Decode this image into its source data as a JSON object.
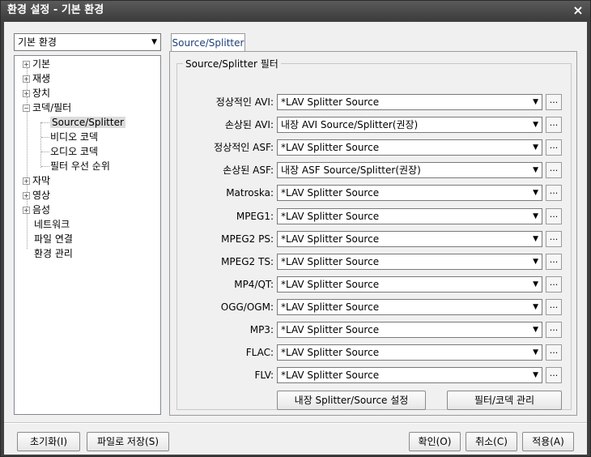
{
  "window": {
    "title": "환경 설정 - 기본 환경",
    "close": "×"
  },
  "left": {
    "combo_value": "기본 환경",
    "tree": [
      {
        "label": "기본",
        "exp": "+"
      },
      {
        "label": "재생",
        "exp": "+"
      },
      {
        "label": "장치",
        "exp": "+"
      },
      {
        "label": "코덱/필터",
        "exp": "−"
      },
      {
        "label": "Source/Splitter"
      },
      {
        "label": "비디오 코덱"
      },
      {
        "label": "오디오 코덱"
      },
      {
        "label": "필터 우선 순위"
      },
      {
        "label": "자막",
        "exp": "+"
      },
      {
        "label": "영상",
        "exp": "+"
      },
      {
        "label": "음성",
        "exp": "+"
      },
      {
        "label": "네트워크"
      },
      {
        "label": "파일 연결"
      },
      {
        "label": "환경 관리"
      }
    ]
  },
  "tab": {
    "label": "Source/Splitter"
  },
  "group": {
    "title": "Source/Splitter 필터"
  },
  "rows": [
    {
      "label": "정상적인 AVI:",
      "value": "*LAV Splitter Source"
    },
    {
      "label": "손상된 AVI:",
      "value": "내장 AVI Source/Splitter(권장)"
    },
    {
      "label": "정상적인 ASF:",
      "value": "*LAV Splitter Source"
    },
    {
      "label": "손상된 ASF:",
      "value": "내장 ASF Source/Splitter(권장)"
    },
    {
      "label": "Matroska:",
      "value": "*LAV Splitter Source"
    },
    {
      "label": "MPEG1:",
      "value": "*LAV Splitter Source"
    },
    {
      "label": "MPEG2 PS:",
      "value": "*LAV Splitter Source"
    },
    {
      "label": "MPEG2 TS:",
      "value": "*LAV Splitter Source"
    },
    {
      "label": "MP4/QT:",
      "value": "*LAV Splitter Source"
    },
    {
      "label": "OGG/OGM:",
      "value": "*LAV Splitter Source"
    },
    {
      "label": "MP3:",
      "value": "*LAV Splitter Source"
    },
    {
      "label": "FLAC:",
      "value": "*LAV Splitter Source"
    },
    {
      "label": "FLV:",
      "value": "*LAV Splitter Source"
    }
  ],
  "mini_button_label": "...",
  "buttons": {
    "builtin_settings": "내장 Splitter/Source 설정",
    "filter_manage": "필터/코덱 관리",
    "reset": "초기화(I)",
    "save_file": "파일로 저장(S)",
    "ok": "확인(O)",
    "cancel": "취소(C)",
    "apply": "적용(A)"
  }
}
